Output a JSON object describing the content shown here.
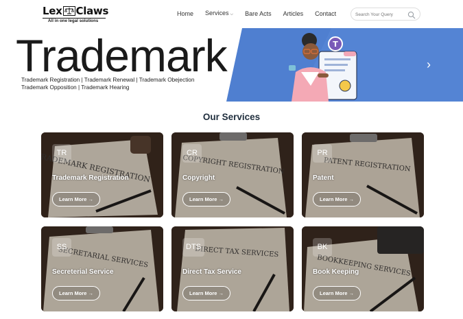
{
  "header": {
    "logo_left": "Lex",
    "logo_right": "Claws",
    "logo_tagline": "All in one legal solutions",
    "nav": [
      {
        "label": "Home"
      },
      {
        "label": "Services"
      },
      {
        "label": "Bare Acts"
      },
      {
        "label": "Articles"
      },
      {
        "label": "Contact"
      }
    ],
    "search_placeholder": "Search Your Query"
  },
  "banner": {
    "title": "Trademark",
    "line1": "Trademark Registration | Trademark Renewal | Trademark Obejection",
    "line2": "Trademark Opposition  | Trademark Hearing",
    "next_arrow": "›",
    "blue_color": "#4f7fd0",
    "illustration_badge": "T"
  },
  "services": {
    "title": "Our Services",
    "button_label": "Learn More →",
    "cards": [
      {
        "badge": "TR",
        "title": "Trademark Registration",
        "doc_text": "TRADEMARK REGISTRATION"
      },
      {
        "badge": "CR",
        "title": "Copyright",
        "doc_text": "COPYRIGHT REGISTRATION"
      },
      {
        "badge": "PR",
        "title": "Patent",
        "doc_text": "PATENT REGISTRATION"
      },
      {
        "badge": "SS",
        "title": "Secreterial Service",
        "doc_text": "SECRETARIAL SERVICES"
      },
      {
        "badge": "DTS",
        "title": "Direct Tax Service",
        "doc_text": "DIRECT TAX SERVICES"
      },
      {
        "badge": "BK",
        "title": "Book Keeping",
        "doc_text": "BOOKKEEPING SERVICES"
      }
    ]
  }
}
